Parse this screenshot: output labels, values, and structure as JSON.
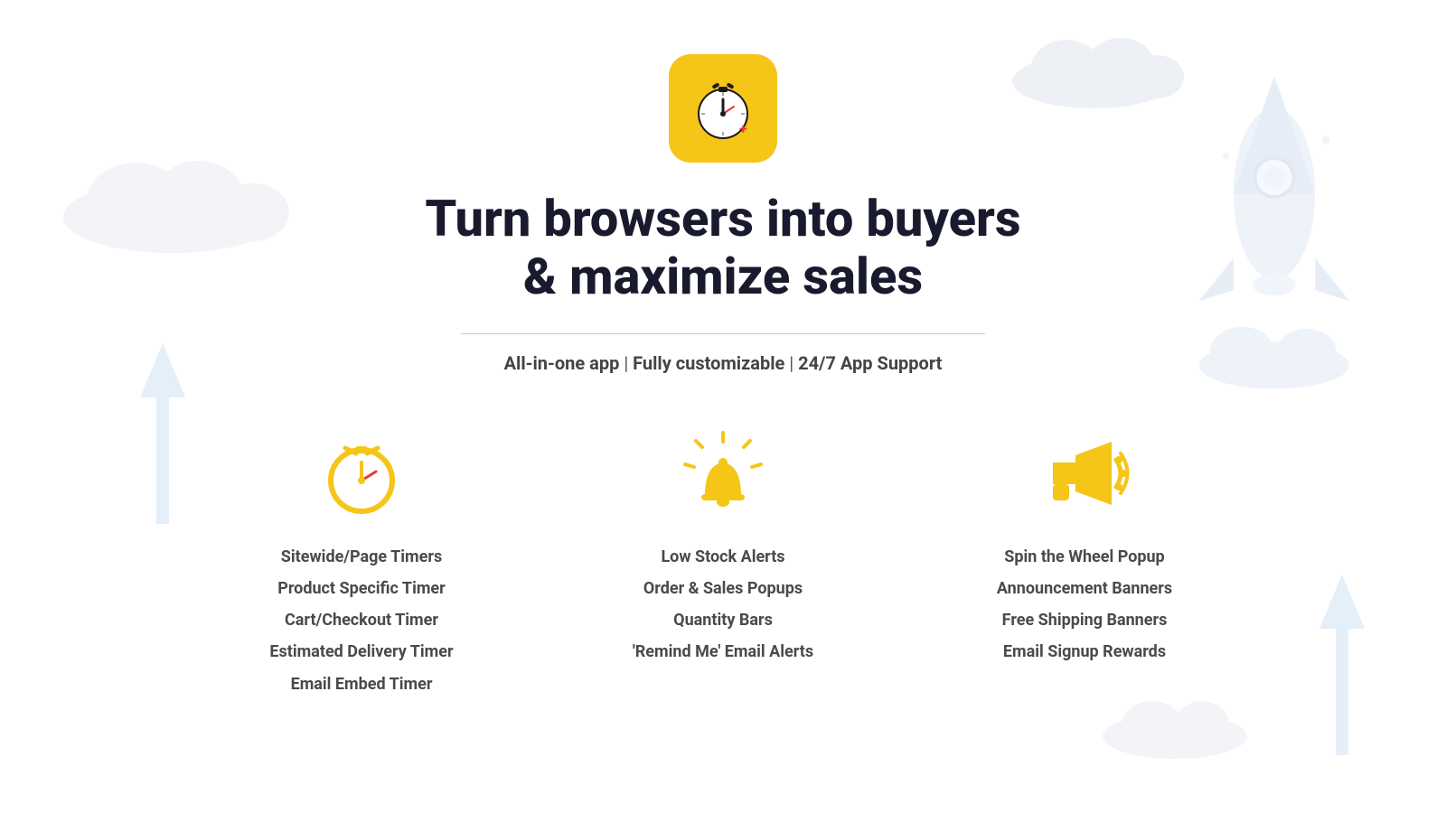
{
  "app": {
    "icon_alt": "Countdown timer app icon"
  },
  "hero": {
    "headline_line1": "Turn browsers into buyers",
    "headline_line2": "& maximize sales",
    "subtitle": "All-in-one app | Fully customizable | 24/7 App Support"
  },
  "features": [
    {
      "id": "timers",
      "icon_name": "stopwatch-icon",
      "items": [
        "Sitewide/Page Timers",
        "Product Specific Timer",
        "Cart/Checkout Timer",
        "Estimated Delivery Timer",
        "Email Embed Timer"
      ]
    },
    {
      "id": "alerts",
      "icon_name": "alert-bell-icon",
      "items": [
        "Low Stock Alerts",
        "Order & Sales Popups",
        "Quantity Bars",
        "'Remind Me' Email Alerts"
      ]
    },
    {
      "id": "marketing",
      "icon_name": "megaphone-icon",
      "items": [
        "Spin the Wheel Popup",
        "Announcement Banners",
        "Free Shipping Banners",
        "Email Signup Rewards"
      ]
    }
  ],
  "colors": {
    "yellow": "#F5C518",
    "dark": "#1a1a2e",
    "gray": "#555555",
    "feature_text": "#4a4a4a",
    "blue_light": "#b8d0f0"
  }
}
